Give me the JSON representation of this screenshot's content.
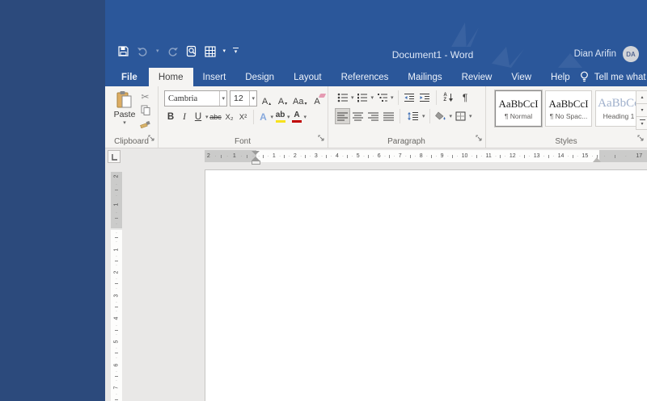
{
  "window": {
    "title": "Document1 - Word"
  },
  "account": {
    "name": "Dian Arifin",
    "initials": "DA"
  },
  "qat_icons": [
    "save-icon",
    "undo-icon",
    "redo-icon",
    "print-preview-icon",
    "draw-table-icon",
    "customize-quick-access-icon"
  ],
  "tabs": {
    "file": "File",
    "items": [
      "Home",
      "Insert",
      "Design",
      "Layout",
      "References",
      "Mailings",
      "Review",
      "View",
      "Help"
    ],
    "active": "Home",
    "tell_me": "Tell me what you want to do"
  },
  "glyphs": {
    "caret_down": "▾",
    "caret_up": "▴",
    "scissors": "✂",
    "pilcrow": "¶",
    "sort_a": "A",
    "sort_z": "Z"
  },
  "ribbon": {
    "clipboard": {
      "label": "Clipboard",
      "paste": "Paste"
    },
    "font": {
      "label": "Font",
      "family": "Cambria",
      "size": "12",
      "grow": "A",
      "shrink": "A",
      "change_case": "Aa",
      "clear_format": "A",
      "bold": "B",
      "italic": "I",
      "underline": "U",
      "strikethrough": "abc",
      "subscript": "X₂",
      "superscript": "X²",
      "text_effects": "A",
      "highlight": "ab",
      "font_color": "A"
    },
    "paragraph": {
      "label": "Paragraph"
    },
    "styles": {
      "label": "Styles",
      "cards": [
        {
          "sample": "AaBbCcI",
          "name": "¶ Normal",
          "selected": true
        },
        {
          "sample": "AaBbCcI",
          "name": "¶ No Spac...",
          "selected": false
        },
        {
          "sample": "AaBbCc",
          "name": "Heading 1",
          "selected": false
        }
      ]
    }
  },
  "ruler": {
    "h_margin_left": [
      "2",
      "1"
    ],
    "h_main": [
      "1",
      "2",
      "3",
      "4",
      "5",
      "6",
      "7",
      "8",
      "9",
      "10",
      "11",
      "12",
      "13",
      "14",
      "15"
    ],
    "h_margin_right": [
      "17"
    ],
    "v_margin_top": [
      "2",
      "1"
    ],
    "v_main": [
      "1",
      "2",
      "3",
      "4",
      "5",
      "6",
      "7"
    ]
  },
  "colors": {
    "desktop_background": "#2c4a7c",
    "title_bar_blue": "#2b579a",
    "ribbon_background": "#f5f4f2",
    "highlight_yellow": "#f7e11e",
    "font_color_red": "#c00000",
    "heading_style_blue": "#9fb0cc"
  }
}
